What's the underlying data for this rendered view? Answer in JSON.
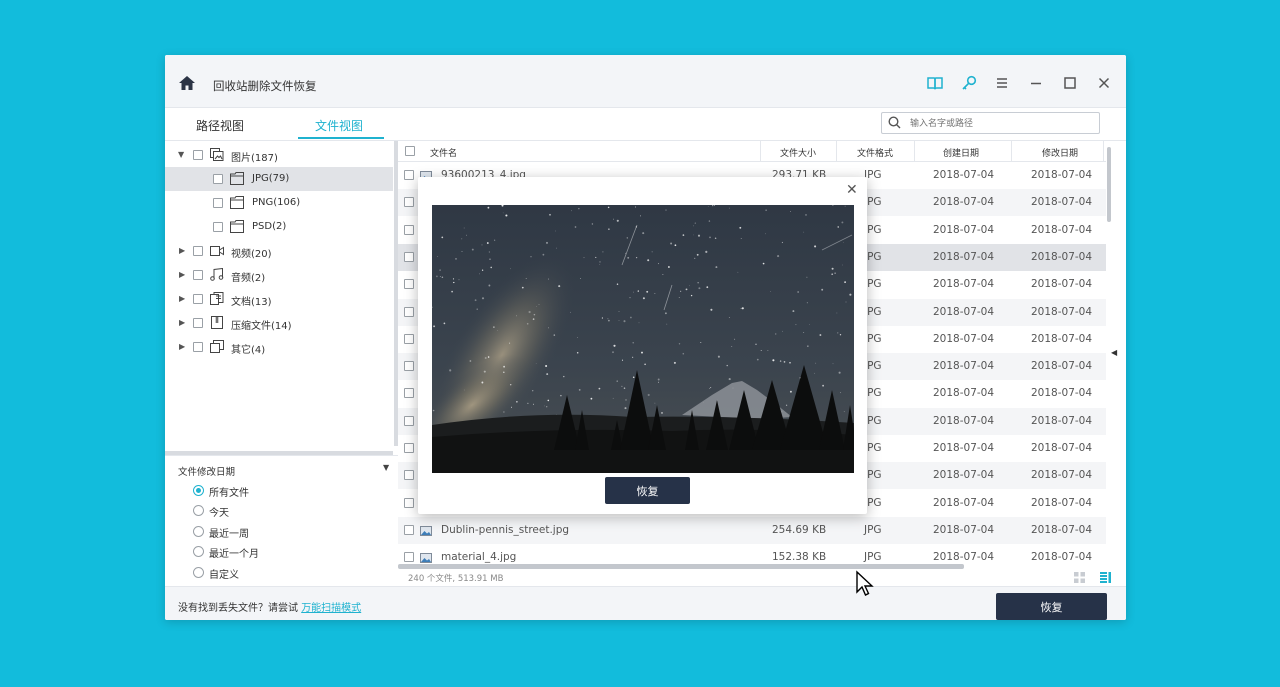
{
  "app": {
    "title": "回收站删除文件恢复"
  },
  "toolbar": {
    "icons": [
      "book-icon",
      "key-icon",
      "menu-icon",
      "minimize-icon",
      "maximize-icon",
      "close-icon"
    ]
  },
  "tabs": [
    {
      "label": "路径视图",
      "active": false
    },
    {
      "label": "文件视图",
      "active": true
    }
  ],
  "search": {
    "placeholder": "输入名字或路径"
  },
  "tree": [
    {
      "label": "图片(187)",
      "expanded": true,
      "icon": "image-icon"
    },
    {
      "label": "JPG(79)",
      "selected": true,
      "icon": "folder-icon"
    },
    {
      "label": "PNG(106)",
      "icon": "folder-icon"
    },
    {
      "label": "PSD(2)",
      "icon": "folder-icon"
    },
    {
      "label": "视频(20)",
      "icon": "video-icon"
    },
    {
      "label": "音频(2)",
      "icon": "music-icon"
    },
    {
      "label": "文档(13)",
      "icon": "document-icon"
    },
    {
      "label": "压缩文件(14)",
      "icon": "archive-icon"
    },
    {
      "label": "其它(4)",
      "icon": "other-icon"
    }
  ],
  "filter": {
    "title": "文件修改日期",
    "options": [
      {
        "label": "所有文件",
        "checked": true
      },
      {
        "label": "今天",
        "checked": false
      },
      {
        "label": "最近一周",
        "checked": false
      },
      {
        "label": "最近一个月",
        "checked": false
      },
      {
        "label": "自定义",
        "checked": false
      }
    ]
  },
  "table": {
    "headers": {
      "name": "文件名",
      "size": "文件大小",
      "format": "文件格式",
      "created": "创建日期",
      "modified": "修改日期"
    },
    "rows": [
      {
        "name": "93600213_4.jpg",
        "size": "293.71 KB",
        "format": "JPG",
        "created": "2018-07-04",
        "modified": "2018-07-04"
      },
      {
        "name": "",
        "size": "",
        "format": "JPG",
        "created": "2018-07-04",
        "modified": "2018-07-04"
      },
      {
        "name": "",
        "size": "",
        "format": "JPG",
        "created": "2018-07-04",
        "modified": "2018-07-04"
      },
      {
        "name": "",
        "size": "",
        "format": "JPG",
        "created": "2018-07-04",
        "modified": "2018-07-04"
      },
      {
        "name": "",
        "size": "",
        "format": "JPG",
        "created": "2018-07-04",
        "modified": "2018-07-04"
      },
      {
        "name": "",
        "size": "",
        "format": "JPG",
        "created": "2018-07-04",
        "modified": "2018-07-04"
      },
      {
        "name": "",
        "size": "",
        "format": "JPG",
        "created": "2018-07-04",
        "modified": "2018-07-04"
      },
      {
        "name": "",
        "size": "",
        "format": "JPG",
        "created": "2018-07-04",
        "modified": "2018-07-04"
      },
      {
        "name": "",
        "size": "",
        "format": "JPG",
        "created": "2018-07-04",
        "modified": "2018-07-04"
      },
      {
        "name": "",
        "size": "",
        "format": "JPG",
        "created": "2018-07-04",
        "modified": "2018-07-04"
      },
      {
        "name": "",
        "size": "",
        "format": "JPG",
        "created": "2018-07-04",
        "modified": "2018-07-04"
      },
      {
        "name": "",
        "size": "",
        "format": "JPG",
        "created": "2018-07-04",
        "modified": "2018-07-04"
      },
      {
        "name": "",
        "size": "",
        "format": "JPG",
        "created": "2018-07-04",
        "modified": "2018-07-04"
      },
      {
        "name": "Dublin-pennis_street.jpg",
        "size": "254.69 KB",
        "format": "JPG",
        "created": "2018-07-04",
        "modified": "2018-07-04"
      },
      {
        "name": "material_4.jpg",
        "size": "152.38 KB",
        "format": "JPG",
        "created": "2018-07-04",
        "modified": "2018-07-04"
      }
    ],
    "status": "240 个文件, 513.91 MB"
  },
  "bottom": {
    "hint": "没有找到丢失文件？请尝试",
    "link": "万能扫描模式",
    "recover": "恢复"
  },
  "preview": {
    "recover": "恢复"
  },
  "colors": {
    "accent": "#1fb2cf",
    "dark_button": "#263248",
    "background": "#12bcdc"
  }
}
